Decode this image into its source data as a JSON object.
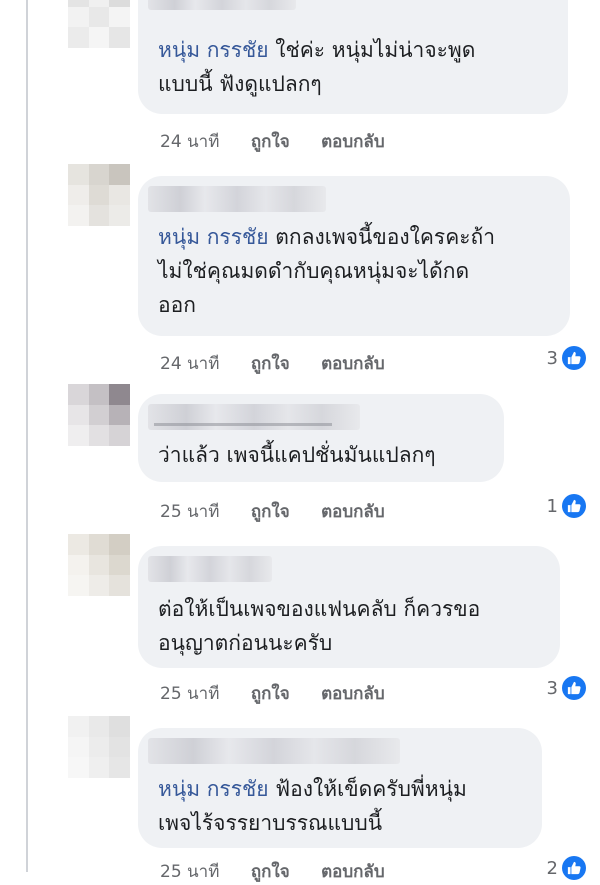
{
  "colors": {
    "name_link": "#365899",
    "bubble_bg": "#eff1f4",
    "meta_text": "#65676b",
    "like_blue": "#1877f2"
  },
  "comments": [
    {
      "tag": "หนุ่ม กรรชัย",
      "text": " ใช่ค่ะ หนุ่มไม่น่าจะพูด\nแบบนี้ ฟังดูแปลกๆ",
      "time": "24 นาที",
      "like_label": "ถูกใจ",
      "reply_label": "ตอบกลับ",
      "reactions": ""
    },
    {
      "tag": "หนุ่ม กรรชัย",
      "text": " ตกลงเพจนี้ของใครคะถ้า\nไม่ใช่คุณมดดำกับคุณหนุ่มจะได้กด\nออก",
      "time": "24 นาที",
      "like_label": "ถูกใจ",
      "reply_label": "ตอบกลับ",
      "reactions": "3"
    },
    {
      "tag": "",
      "text": "ว่าแล้ว เพจนี้แคปชั่นมันแปลกๆ",
      "time": "25 นาที",
      "like_label": "ถูกใจ",
      "reply_label": "ตอบกลับ",
      "reactions": "1"
    },
    {
      "tag": "",
      "text": "ต่อให้เป็นเพจของแฟนคลับ ก็ควรขอ\nอนุญาตก่อนนะครับ",
      "time": "25 นาที",
      "like_label": "ถูกใจ",
      "reply_label": "ตอบกลับ",
      "reactions": "3"
    },
    {
      "tag": "หนุ่ม กรรชัย",
      "text": " ฟ้องให้เข็ดครับพี่หนุ่ม\nเพจไร้จรรยาบรรณแบบนี้",
      "time": "25 นาที",
      "like_label": "ถูกใจ",
      "reply_label": "ตอบกลับ",
      "reactions": "2"
    }
  ]
}
